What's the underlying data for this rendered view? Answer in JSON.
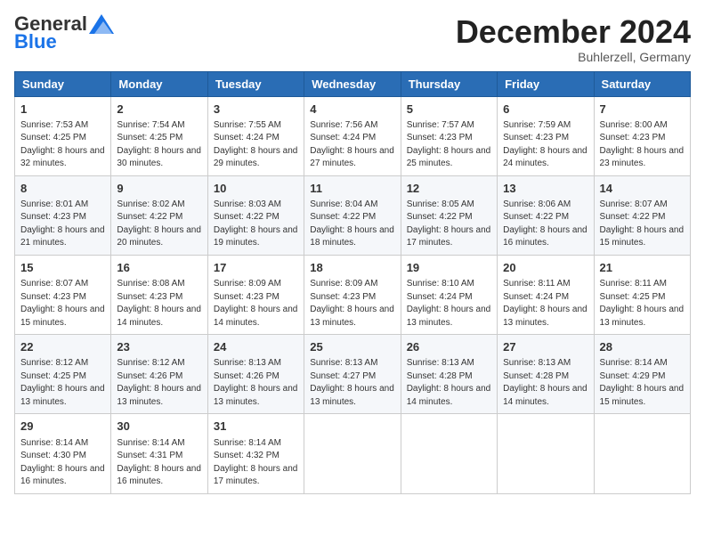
{
  "logo": {
    "general": "General",
    "blue": "Blue"
  },
  "header": {
    "month": "December 2024",
    "location": "Buhlerzell, Germany"
  },
  "weekdays": [
    "Sunday",
    "Monday",
    "Tuesday",
    "Wednesday",
    "Thursday",
    "Friday",
    "Saturday"
  ],
  "weeks": [
    [
      {
        "day": "1",
        "sunrise": "7:53 AM",
        "sunset": "4:25 PM",
        "daylight": "8 hours and 32 minutes."
      },
      {
        "day": "2",
        "sunrise": "7:54 AM",
        "sunset": "4:25 PM",
        "daylight": "8 hours and 30 minutes."
      },
      {
        "day": "3",
        "sunrise": "7:55 AM",
        "sunset": "4:24 PM",
        "daylight": "8 hours and 29 minutes."
      },
      {
        "day": "4",
        "sunrise": "7:56 AM",
        "sunset": "4:24 PM",
        "daylight": "8 hours and 27 minutes."
      },
      {
        "day": "5",
        "sunrise": "7:57 AM",
        "sunset": "4:23 PM",
        "daylight": "8 hours and 25 minutes."
      },
      {
        "day": "6",
        "sunrise": "7:59 AM",
        "sunset": "4:23 PM",
        "daylight": "8 hours and 24 minutes."
      },
      {
        "day": "7",
        "sunrise": "8:00 AM",
        "sunset": "4:23 PM",
        "daylight": "8 hours and 23 minutes."
      }
    ],
    [
      {
        "day": "8",
        "sunrise": "8:01 AM",
        "sunset": "4:23 PM",
        "daylight": "8 hours and 21 minutes."
      },
      {
        "day": "9",
        "sunrise": "8:02 AM",
        "sunset": "4:22 PM",
        "daylight": "8 hours and 20 minutes."
      },
      {
        "day": "10",
        "sunrise": "8:03 AM",
        "sunset": "4:22 PM",
        "daylight": "8 hours and 19 minutes."
      },
      {
        "day": "11",
        "sunrise": "8:04 AM",
        "sunset": "4:22 PM",
        "daylight": "8 hours and 18 minutes."
      },
      {
        "day": "12",
        "sunrise": "8:05 AM",
        "sunset": "4:22 PM",
        "daylight": "8 hours and 17 minutes."
      },
      {
        "day": "13",
        "sunrise": "8:06 AM",
        "sunset": "4:22 PM",
        "daylight": "8 hours and 16 minutes."
      },
      {
        "day": "14",
        "sunrise": "8:07 AM",
        "sunset": "4:22 PM",
        "daylight": "8 hours and 15 minutes."
      }
    ],
    [
      {
        "day": "15",
        "sunrise": "8:07 AM",
        "sunset": "4:23 PM",
        "daylight": "8 hours and 15 minutes."
      },
      {
        "day": "16",
        "sunrise": "8:08 AM",
        "sunset": "4:23 PM",
        "daylight": "8 hours and 14 minutes."
      },
      {
        "day": "17",
        "sunrise": "8:09 AM",
        "sunset": "4:23 PM",
        "daylight": "8 hours and 14 minutes."
      },
      {
        "day": "18",
        "sunrise": "8:09 AM",
        "sunset": "4:23 PM",
        "daylight": "8 hours and 13 minutes."
      },
      {
        "day": "19",
        "sunrise": "8:10 AM",
        "sunset": "4:24 PM",
        "daylight": "8 hours and 13 minutes."
      },
      {
        "day": "20",
        "sunrise": "8:11 AM",
        "sunset": "4:24 PM",
        "daylight": "8 hours and 13 minutes."
      },
      {
        "day": "21",
        "sunrise": "8:11 AM",
        "sunset": "4:25 PM",
        "daylight": "8 hours and 13 minutes."
      }
    ],
    [
      {
        "day": "22",
        "sunrise": "8:12 AM",
        "sunset": "4:25 PM",
        "daylight": "8 hours and 13 minutes."
      },
      {
        "day": "23",
        "sunrise": "8:12 AM",
        "sunset": "4:26 PM",
        "daylight": "8 hours and 13 minutes."
      },
      {
        "day": "24",
        "sunrise": "8:13 AM",
        "sunset": "4:26 PM",
        "daylight": "8 hours and 13 minutes."
      },
      {
        "day": "25",
        "sunrise": "8:13 AM",
        "sunset": "4:27 PM",
        "daylight": "8 hours and 13 minutes."
      },
      {
        "day": "26",
        "sunrise": "8:13 AM",
        "sunset": "4:28 PM",
        "daylight": "8 hours and 14 minutes."
      },
      {
        "day": "27",
        "sunrise": "8:13 AM",
        "sunset": "4:28 PM",
        "daylight": "8 hours and 14 minutes."
      },
      {
        "day": "28",
        "sunrise": "8:14 AM",
        "sunset": "4:29 PM",
        "daylight": "8 hours and 15 minutes."
      }
    ],
    [
      {
        "day": "29",
        "sunrise": "8:14 AM",
        "sunset": "4:30 PM",
        "daylight": "8 hours and 16 minutes."
      },
      {
        "day": "30",
        "sunrise": "8:14 AM",
        "sunset": "4:31 PM",
        "daylight": "8 hours and 16 minutes."
      },
      {
        "day": "31",
        "sunrise": "8:14 AM",
        "sunset": "4:32 PM",
        "daylight": "8 hours and 17 minutes."
      },
      null,
      null,
      null,
      null
    ]
  ]
}
